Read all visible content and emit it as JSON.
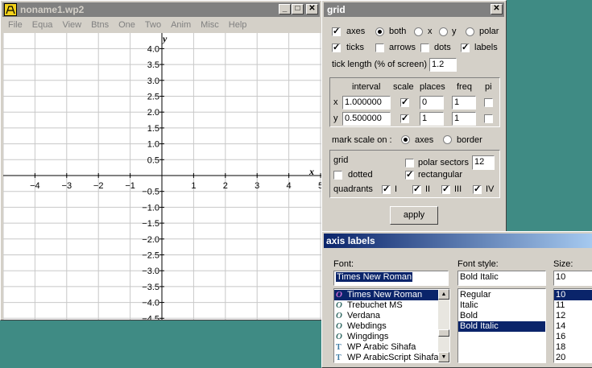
{
  "main_window": {
    "title": "noname1.wp2",
    "menu": [
      "File",
      "Equa",
      "View",
      "Btns",
      "One",
      "Two",
      "Anim",
      "Misc",
      "Help"
    ]
  },
  "graph": {
    "x_axis_label": "x",
    "y_axis_label": "y",
    "x_ticks": [
      "−4",
      "−3",
      "−2",
      "−1",
      "1",
      "2",
      "3",
      "4",
      "5"
    ],
    "y_ticks_pos": [
      "4.0",
      "3.5",
      "3.0",
      "2.5",
      "2.0",
      "1.5",
      "1.0",
      "0.5"
    ],
    "y_ticks_neg": [
      "−0.5",
      "−1.0",
      "−1.5",
      "−2.0",
      "−2.5",
      "−3.0",
      "−3.5",
      "−4.0",
      "−4.5"
    ]
  },
  "grid_dialog": {
    "title": "grid",
    "axes_label": "axes",
    "axes_checked": true,
    "both_label": "both",
    "x_label": "x",
    "y_label": "y",
    "polar_label": "polar",
    "axes_mode": "both",
    "ticks_label": "ticks",
    "ticks_checked": true,
    "arrows_label": "arrows",
    "arrows_checked": false,
    "dots_label": "dots",
    "dots_checked": false,
    "labels_label": "labels",
    "labels_checked": true,
    "tick_length_label": "tick length (% of screen)",
    "tick_length_value": "1.2",
    "col_interval": "interval",
    "col_scale": "scale",
    "col_places": "places",
    "col_freq": "freq",
    "col_pi": "pi",
    "row_x": {
      "name": "x",
      "interval": "1.000000",
      "scale": true,
      "places": "0",
      "freq": "1",
      "pi": false
    },
    "row_y": {
      "name": "y",
      "interval": "0.500000",
      "scale": true,
      "places": "1",
      "freq": "1",
      "pi": false
    },
    "mark_scale_label": "mark scale on :",
    "mark_axes_label": "axes",
    "mark_border_label": "border",
    "mark_scale_on": "axes",
    "grid_label": "grid",
    "dotted_label": "dotted",
    "dotted_checked": false,
    "polar_sectors_label": "polar sectors",
    "polar_sectors_checked": false,
    "polar_sectors_value": "12",
    "rectangular_label": "rectangular",
    "rectangular_checked": true,
    "quadrants_label": "quadrants",
    "q1_label": "I",
    "q2_label": "II",
    "q3_label": "III",
    "q4_label": "IV",
    "apply_label": "apply"
  },
  "axis_labels_dialog": {
    "title": "axis labels",
    "font_label": "Font:",
    "font_value": "Times New Roman",
    "fonts": [
      {
        "name": "Times New Roman",
        "icon": "O",
        "selected": true
      },
      {
        "name": "Trebuchet MS",
        "icon": "O",
        "selected": false
      },
      {
        "name": "Verdana",
        "icon": "O",
        "selected": false
      },
      {
        "name": "Webdings",
        "icon": "O",
        "selected": false
      },
      {
        "name": "Wingdings",
        "icon": "O",
        "selected": false
      },
      {
        "name": "WP Arabic Sihafa",
        "icon": "TT",
        "selected": false
      },
      {
        "name": "WP ArabicScript Sihafa",
        "icon": "TT",
        "selected": false
      }
    ],
    "style_label": "Font style:",
    "style_value": "Bold Italic",
    "styles": [
      "Regular",
      "Italic",
      "Bold",
      "Bold Italic"
    ],
    "style_selected": "Bold Italic",
    "size_label": "Size:",
    "size_value": "10",
    "sizes": [
      "10",
      "11",
      "12",
      "14",
      "16",
      "18",
      "20"
    ],
    "size_selected": "10"
  }
}
